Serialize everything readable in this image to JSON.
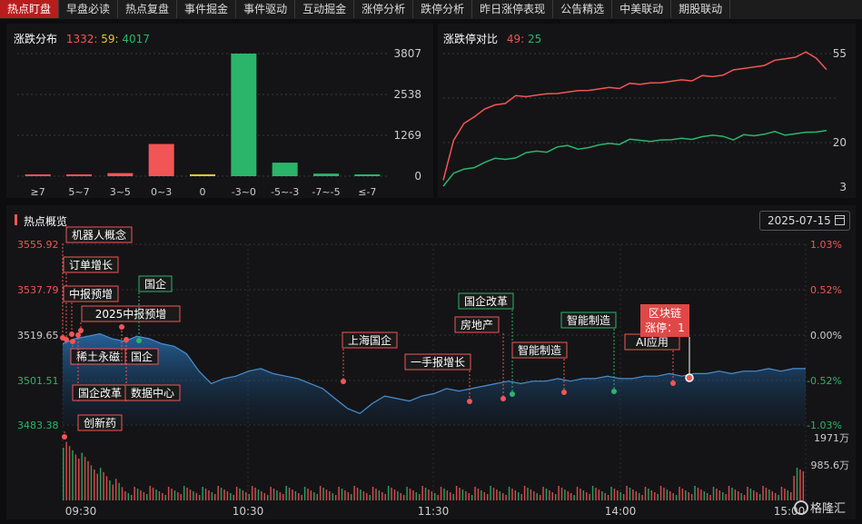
{
  "tabs": [
    "热点盯盘",
    "早盘必读",
    "热点复盘",
    "事件掘金",
    "事件驱动",
    "互动掘金",
    "涨停分析",
    "跌停分析",
    "昨日涨停表现",
    "公告精选",
    "中美联动",
    "期股联动"
  ],
  "distribution": {
    "title": "涨跌分布",
    "up": "1332:",
    "flat": "59:",
    "down": "4017"
  },
  "ratio": {
    "title": "涨跌停对比",
    "up": "49:",
    "down": "25"
  },
  "hot": {
    "title": "热点概览",
    "date": "2025-07-15"
  },
  "logo": "格隆汇",
  "colors": {
    "up": "#f25555",
    "down": "#2bb56a",
    "flat": "#e8c432",
    "accent": "#b81d1d"
  },
  "chart_data": [
    {
      "type": "bar",
      "categories": [
        "≥7",
        "5~7",
        "3~5",
        "0~3",
        "0",
        "-3~0",
        "-5~-3",
        "-7~-5",
        "≤-7"
      ],
      "values": [
        45,
        35,
        95,
        1000,
        59,
        3807,
        420,
        80,
        50
      ],
      "yticks": [
        "3807",
        "2538",
        "1269",
        "0"
      ],
      "ylim": [
        0,
        3807
      ]
    },
    {
      "type": "line",
      "yticks": [
        "55",
        "20",
        "3"
      ],
      "series": [
        {
          "values": [
            5,
            21,
            28,
            31,
            33,
            35,
            36,
            38,
            38,
            39,
            40,
            39,
            40,
            41,
            40,
            41,
            42,
            42,
            43,
            43,
            44,
            43,
            44,
            45,
            45,
            46,
            46,
            47,
            48,
            49,
            50,
            51,
            52,
            53,
            54,
            55,
            53,
            49
          ]
        },
        {
          "values": [
            4,
            8,
            10,
            11,
            12,
            14,
            14,
            15,
            16,
            17,
            17,
            18,
            19,
            18,
            19,
            19,
            20,
            20,
            21,
            21,
            21,
            22,
            21,
            22,
            22,
            22,
            23,
            23,
            22,
            23,
            23,
            24,
            24,
            23,
            24,
            25,
            24,
            25
          ]
        }
      ]
    },
    {
      "type": "area",
      "x_ticks": [
        "09:30",
        "10:30",
        "11:30",
        "14:00",
        "15:00"
      ],
      "y_left": [
        "3555.92",
        "3537.79",
        "3519.65",
        "3501.51",
        "3483.38"
      ],
      "y_right": [
        "1.03%",
        "0.52%",
        "0.00%",
        "-0.52%",
        "-1.03%"
      ],
      "volume_ticks": [
        "1971万",
        "985.6万"
      ],
      "ylim": [
        3483.38,
        3555.92
      ],
      "values": [
        3516,
        3518,
        3519,
        3520,
        3518,
        3517,
        3519,
        3518,
        3516,
        3515,
        3512,
        3505,
        3500,
        3502,
        3503,
        3505,
        3506,
        3504,
        3503,
        3502,
        3500,
        3498,
        3494,
        3490,
        3488,
        3492,
        3495,
        3494,
        3493,
        3495,
        3496,
        3498,
        3497,
        3498,
        3499,
        3500,
        3501,
        3500,
        3501,
        3501,
        3502,
        3501,
        3502,
        3502,
        3503,
        3502,
        3502,
        3503,
        3503,
        3504,
        3503,
        3504,
        3504,
        3505,
        3504,
        3505,
        3505,
        3506,
        3505,
        3506,
        3506
      ],
      "annotations": [
        {
          "text": "机器人概念",
          "kind": "up"
        },
        {
          "text": "订单增长",
          "kind": "up"
        },
        {
          "text": "中报预增",
          "kind": "up"
        },
        {
          "text": "2025中报预增",
          "kind": "up"
        },
        {
          "text": "国企",
          "kind": "down"
        },
        {
          "text": "稀土永磁",
          "kind": "up"
        },
        {
          "text": "国企",
          "kind": "up"
        },
        {
          "text": "国企改革",
          "kind": "up"
        },
        {
          "text": "数据中心",
          "kind": "up"
        },
        {
          "text": "创新药",
          "kind": "up"
        },
        {
          "text": "上海国企",
          "kind": "up"
        },
        {
          "text": "一手报增长",
          "kind": "up"
        },
        {
          "text": "房地产",
          "kind": "up"
        },
        {
          "text": "国企改革",
          "kind": "down"
        },
        {
          "text": "智能制造",
          "kind": "up"
        },
        {
          "text": "智能制造",
          "kind": "down"
        },
        {
          "text": "AI应用",
          "kind": "up"
        },
        {
          "text": "区块链",
          "kind": "hl"
        },
        {
          "text": "涨停：1",
          "kind": "hl"
        }
      ]
    }
  ]
}
